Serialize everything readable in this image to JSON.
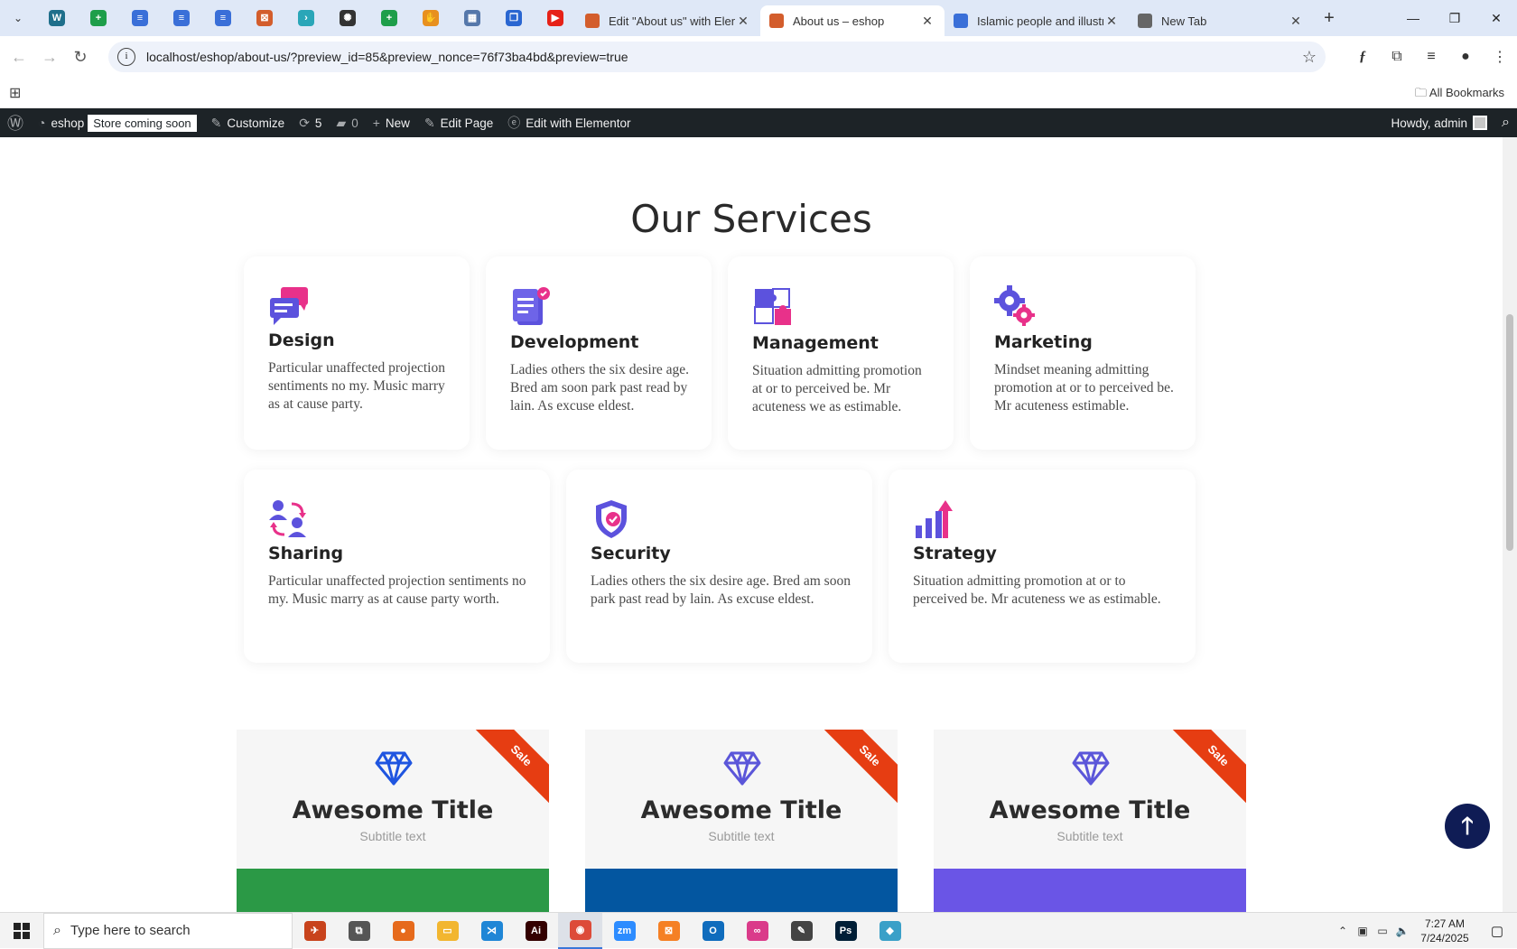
{
  "browser": {
    "tabs": [
      {
        "title": "Edit \"About us\" with Elementor",
        "icon": "elementor-icon",
        "color": "#d35d2c"
      },
      {
        "title": "About us – eshop",
        "icon": "elementor-icon",
        "color": "#d35d2c",
        "active": true
      },
      {
        "title": "Islamic people and illustrations",
        "icon": "docs-icon",
        "color": "#3a6fd8"
      },
      {
        "title": "New Tab",
        "icon": "chrome-icon",
        "color": "#666666"
      }
    ],
    "pinned": [
      {
        "name": "wordpress-pin-icon",
        "color": "#1f6f8b",
        "glyph": "W"
      },
      {
        "name": "sheets-pin-icon",
        "color": "#1e9e4a",
        "glyph": "+"
      },
      {
        "name": "docs-pin-icon",
        "color": "#3a6fd8",
        "glyph": "≡"
      },
      {
        "name": "docs-pin-icon-2",
        "color": "#3a6fd8",
        "glyph": "≡"
      },
      {
        "name": "docs-pin-icon-3",
        "color": "#3a6fd8",
        "glyph": "≡"
      },
      {
        "name": "elementor-pin-icon",
        "color": "#d35d2c",
        "glyph": "⊠"
      },
      {
        "name": "arrow-pin-icon",
        "color": "#2aa6b8",
        "glyph": "›"
      },
      {
        "name": "openai-pin-icon",
        "color": "#333333",
        "glyph": "✺"
      },
      {
        "name": "sheets-pin-icon-2",
        "color": "#1e9e4a",
        "glyph": "+"
      },
      {
        "name": "hand-pin-icon",
        "color": "#e8901f",
        "glyph": "✋"
      },
      {
        "name": "grid-pin-icon",
        "color": "#5577aa",
        "glyph": "▦"
      },
      {
        "name": "forms-pin-icon",
        "color": "#2a66d1",
        "glyph": "❐"
      },
      {
        "name": "youtube-pin-icon",
        "color": "#e62117",
        "glyph": "▶"
      }
    ],
    "url": "localhost/eshop/about-us/?preview_id=85&preview_nonce=76f73ba4bd&preview=true",
    "all_bookmarks": "All Bookmarks"
  },
  "wp_admin_bar": {
    "site": "eshop",
    "store_badge": "Store coming soon",
    "customize": "Customize",
    "updates": "5",
    "comments": "0",
    "new": "New",
    "edit_page": "Edit Page",
    "edit_elementor": "Edit with Elementor",
    "howdy": "Howdy, admin"
  },
  "services": {
    "heading": "Our Services",
    "items": [
      {
        "title": "Design",
        "text": "Particular unaffected projection sentiments no my. Music marry as at cause party.",
        "icon": "chat-bubbles-icon"
      },
      {
        "title": "Development",
        "text": "Ladies others the six desire age. Bred am soon park past read by lain. As excuse eldest.",
        "icon": "document-check-icon"
      },
      {
        "title": "Management",
        "text": "Situation admitting promotion at or to perceived be. Mr acuteness we as estimable.",
        "icon": "puzzle-icon"
      },
      {
        "title": "Marketing",
        "text": "Mindset meaning admitting promotion at or to perceived be. Mr acuteness estimable.",
        "icon": "gears-icon"
      },
      {
        "title": "Sharing",
        "text": "Particular unaffected projection sentiments no my. Music marry as at cause party worth.",
        "icon": "people-exchange-icon"
      },
      {
        "title": "Security",
        "text": "Ladies others the six desire age. Bred am soon park past read by lain. As excuse eldest.",
        "icon": "shield-check-icon"
      },
      {
        "title": "Strategy",
        "text": "Situation admitting promotion at or to perceived be. Mr acuteness we as estimable.",
        "icon": "growth-chart-icon"
      }
    ]
  },
  "pricing": [
    {
      "title": "Awesome Title",
      "subtitle": "Subtitle text",
      "ribbon": "Sale",
      "band_color": "#2b9946",
      "diamond_color": "#1f55e0"
    },
    {
      "title": "Awesome Title",
      "subtitle": "Subtitle text",
      "ribbon": "Sale",
      "band_color": "#0356a0",
      "diamond_color": "#5b56d9"
    },
    {
      "title": "Awesome Title",
      "subtitle": "Subtitle text",
      "ribbon": "Sale",
      "band_color": "#6a55e6",
      "diamond_color": "#5b56d9"
    }
  ],
  "taskbar": {
    "search_placeholder": "Type here to search",
    "time": "7:27 AM",
    "date": "7/24/2025",
    "apps": [
      {
        "name": "cortana-icon",
        "color": "#c8431c",
        "glyph": "✈"
      },
      {
        "name": "task-view-icon",
        "color": "#555555",
        "glyph": "⧉"
      },
      {
        "name": "firefox-icon",
        "color": "#e66a1c",
        "glyph": "●"
      },
      {
        "name": "file-explorer-icon",
        "color": "#f2b630",
        "glyph": "▭"
      },
      {
        "name": "vscode-icon",
        "color": "#1f86d6",
        "glyph": "⋊"
      },
      {
        "name": "illustrator-icon",
        "color": "#330000",
        "glyph": "Ai"
      },
      {
        "name": "chrome-icon",
        "color": "#dd4b39",
        "glyph": "◉",
        "active": true
      },
      {
        "name": "zoom-icon",
        "color": "#2d8cff",
        "glyph": "zm"
      },
      {
        "name": "xampp-icon",
        "color": "#f58024",
        "glyph": "⊠"
      },
      {
        "name": "outlook-icon",
        "color": "#0f6cbd",
        "glyph": "O"
      },
      {
        "name": "creative-cloud-icon",
        "color": "#da3b8a",
        "glyph": "∞"
      },
      {
        "name": "pen-tool-icon",
        "color": "#444444",
        "glyph": "✎"
      },
      {
        "name": "photoshop-icon",
        "color": "#001e36",
        "glyph": "Ps"
      },
      {
        "name": "app-icon",
        "color": "#3aa0c8",
        "glyph": "◆"
      }
    ]
  }
}
